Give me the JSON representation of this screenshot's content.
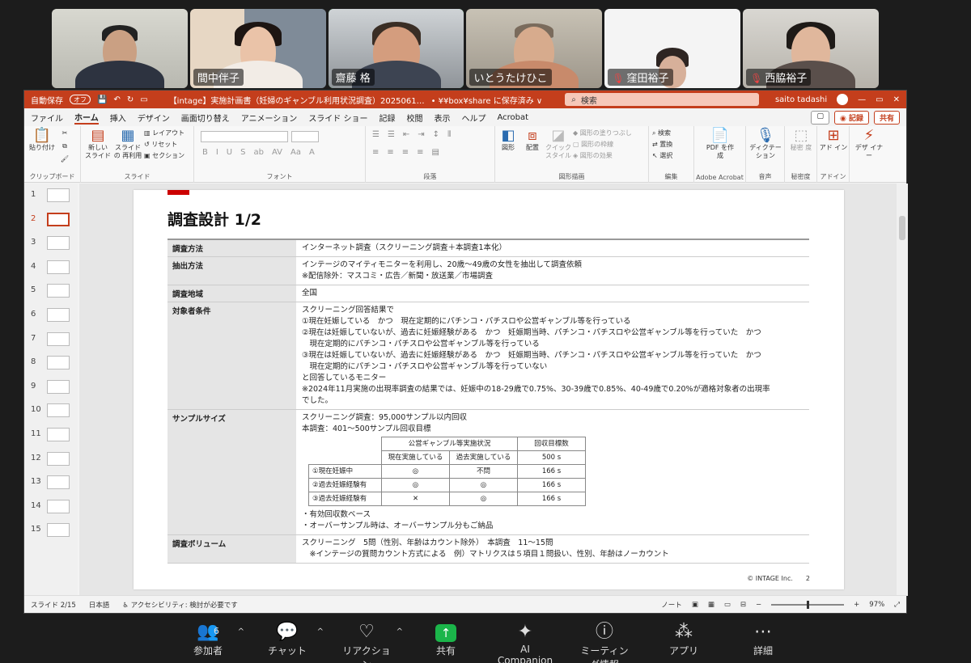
{
  "participants": [
    {
      "name": "",
      "muted": false
    },
    {
      "name": "間中伴子",
      "muted": false
    },
    {
      "name": "齋藤 格",
      "muted": false,
      "active": true
    },
    {
      "name": "いとうたけひこ",
      "muted": false
    },
    {
      "name": "窪田裕子",
      "muted": true
    },
    {
      "name": "西脇裕子",
      "muted": true
    }
  ],
  "ppt": {
    "titlebar": {
      "autosave": "自動保存",
      "toggle": "オフ",
      "filename": "【intage】実施計画書（妊婦のギャンブル利用状況調査）2025061…",
      "location": "• ¥¥box¥share に保存済み ∨",
      "search": "検索",
      "user": "saito tadashi",
      "win_controls": [
        "—",
        "▭",
        "✕"
      ]
    },
    "menu": {
      "tabs": [
        "ファイル",
        "ホーム",
        "挿入",
        "デザイン",
        "画面切り替え",
        "アニメーション",
        "スライド ショー",
        "記録",
        "校閲",
        "表示",
        "ヘルプ",
        "Acrobat"
      ],
      "active": "ホーム",
      "record": "◉ 記録",
      "share": "共有"
    },
    "ribbon": {
      "groups": [
        "クリップボード",
        "スライド",
        "フォント",
        "段落",
        "図形描画",
        "編集",
        "Adobe Acrobat",
        "音声",
        "秘密度",
        "アドイン"
      ],
      "paste": "貼り付け",
      "new_slide": "新しい スライド",
      "reuse": "スライドの 再利用",
      "layout": "レイアウト",
      "reset": "リセット",
      "section": "セクション",
      "shape": "図形",
      "arrange": "配置",
      "quick_style": "クイック スタイル",
      "fill": "図形の塗りつぶし",
      "outline": "図形の枠線",
      "effect": "図形の効果",
      "find": "検索",
      "replace": "置換",
      "select": "選択",
      "pdf": "PDF を作成",
      "dictate": "ディクテー ション",
      "sensitivity": "秘密 度",
      "addin": "アド イン",
      "designer": "デザ イナー"
    },
    "thumbs": [
      "1",
      "2",
      "3",
      "4",
      "5",
      "6",
      "7",
      "8",
      "9",
      "10",
      "11",
      "12",
      "13",
      "14",
      "15"
    ],
    "selected_thumb": "2",
    "slide": {
      "title": "調査設計 1/2",
      "rows": [
        {
          "k": "調査方法",
          "v": [
            "インターネット調査（スクリーニング調査＋本調査1本化）"
          ]
        },
        {
          "k": "抽出方法",
          "v": [
            "インテージのマイティモニターを利用し、20歳～49歳の女性を抽出して調査依頼",
            "※配信除外：マスコミ・広告／新聞・放送業／市場調査"
          ]
        },
        {
          "k": "調査地域",
          "v": [
            "全国"
          ]
        },
        {
          "k": "対象者条件",
          "v": [
            "スクリーニング回答結果で",
            "①現在妊娠している　かつ　現在定期的にパチンコ・パチスロや公営ギャンブル等を行っている",
            "②現在は妊娠していないが、過去に妊娠経験がある　かつ　妊娠期当時、パチンコ・パチスロや公営ギャンブル等を行っていた　かつ",
            "　現在定期的にパチンコ・パチスロや公営ギャンブル等を行っている",
            "③現在は妊娠していないが、過去に妊娠経験がある　かつ　妊娠期当時、パチンコ・パチスロや公営ギャンブル等を行っていた　かつ",
            "　現在定期的にパチンコ・パチスロや公営ギャンブル等を行っていない",
            "と回答しているモニター",
            "※2024年11月実施の出現率調査の結果では、妊娠中の18-29歳で0.75%、30-39歳で0.85%、40-49歳で0.20%が適格対象者の出現率",
            "でした。"
          ]
        }
      ],
      "sample": {
        "k": "サンプルサイズ",
        "lines": [
          "スクリーニング調査：95,000サンプル以内回収",
          "本調査：401～500サンプル回収目標"
        ],
        "table": {
          "h1": "公営ギャンブル等実施状況",
          "h2": "回収目標数",
          "c1": "現在実施している",
          "c2": "過去実施している",
          "total": "500 s",
          "rows": [
            [
              "①現在妊娠中",
              "◎",
              "不問",
              "166 s"
            ],
            [
              "②過去妊娠経験有",
              "◎",
              "◎",
              "166 s"
            ],
            [
              "③過去妊娠経験有",
              "✕",
              "◎",
              "166 s"
            ]
          ]
        },
        "notes": [
          "・有効回収数ベース",
          "・オーバーサンプル時は、オーバーサンプル分もご納品"
        ]
      },
      "volume": {
        "k": "調査ボリューム",
        "v": [
          "スクリーニング　5問（性別、年齢はカウント除外）　本調査　11～15問",
          "　※インテージの質問カウント方式による　例）マトリクスは５項目１問扱い、性別、年齢はノーカウント"
        ]
      },
      "footer": "© INTAGE Inc.　　2"
    },
    "status": {
      "slide": "スライド 2/15",
      "lang": "日本語",
      "access": "アクセシビリティ: 検討が必要です",
      "note": "ノート",
      "zoom": "97%"
    }
  },
  "zoom_toolbar": [
    {
      "label": "参加者",
      "glyph": "👥",
      "count": "6",
      "caret": true
    },
    {
      "label": "チャット",
      "glyph": "💬",
      "caret": true
    },
    {
      "label": "リアクション",
      "glyph": "♡",
      "caret": true
    },
    {
      "label": "共有",
      "glyph": "↑"
    },
    {
      "label": "AI Companion",
      "glyph": "✦"
    },
    {
      "label": "ミーティング情報",
      "glyph": "ⓘ"
    },
    {
      "label": "アプリ",
      "glyph": "⁂"
    },
    {
      "label": "詳細",
      "glyph": "⋯"
    }
  ]
}
